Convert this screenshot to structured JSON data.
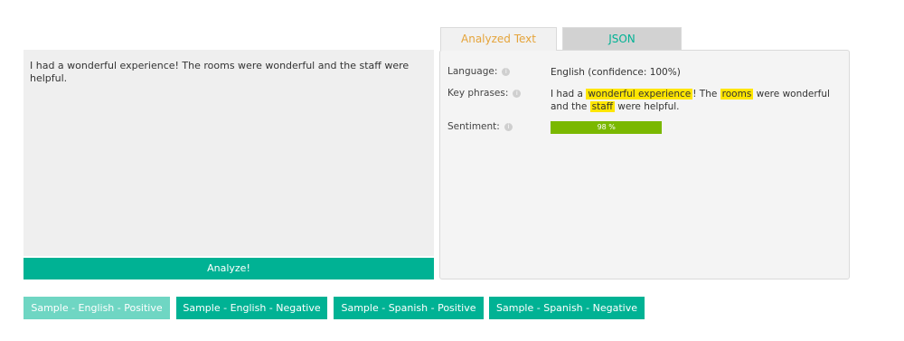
{
  "input": {
    "text": "I had a wonderful experience! The rooms were wonderful and the staff were helpful."
  },
  "analyze_label": "Analyze!",
  "tabs": [
    {
      "label": "Analyzed Text",
      "active": true
    },
    {
      "label": "JSON",
      "active": false
    }
  ],
  "results": {
    "language_label": "Language:",
    "language_value": "English (confidence: 100%)",
    "keyphrases_label": "Key phrases:",
    "keyphrases_segments": [
      {
        "text": "I had a ",
        "highlight": false
      },
      {
        "text": "wonderful experience",
        "highlight": true
      },
      {
        "text": "! The ",
        "highlight": false
      },
      {
        "text": "rooms",
        "highlight": true
      },
      {
        "text": " were wonderful and the ",
        "highlight": false
      },
      {
        "text": "staff",
        "highlight": true
      },
      {
        "text": " were helpful.",
        "highlight": false
      }
    ],
    "sentiment_label": "Sentiment:",
    "sentiment_percent": 98,
    "sentiment_text": "98 %",
    "info_icon": "i"
  },
  "samples": [
    {
      "label": "Sample - English - Positive",
      "active": true
    },
    {
      "label": "Sample - English - Negative",
      "active": false
    },
    {
      "label": "Sample - Spanish - Positive",
      "active": false
    },
    {
      "label": "Sample - Spanish - Negative",
      "active": false
    }
  ],
  "colors": {
    "accent": "#00b294",
    "accent_light": "#6fd6c3",
    "highlight": "#ffe600",
    "sentiment_bar": "#7ab800",
    "tab_active_text": "#e5a43a"
  }
}
